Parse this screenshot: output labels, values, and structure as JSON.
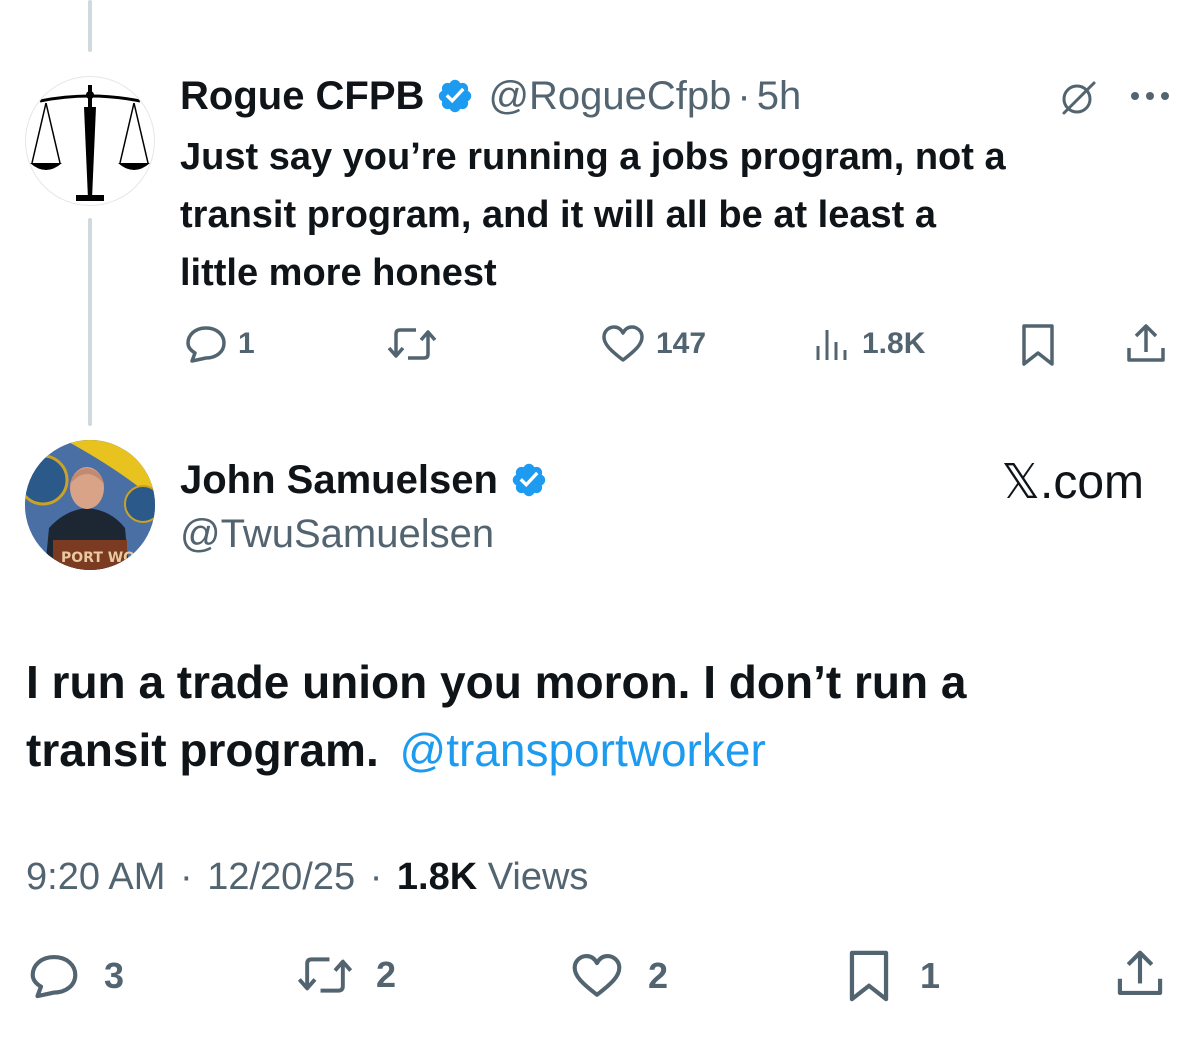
{
  "parent_tweet": {
    "display_name": "Rogue CFPB",
    "handle": "@RogueCfpb",
    "separator": "·",
    "time": "5h",
    "text_lines": [
      "Just say you’re running a jobs program, not a",
      "transit program, and it will all be at least a",
      "little more honest"
    ],
    "actions": {
      "reply_count": "1",
      "retweet_count": "",
      "like_count": "147",
      "view_count": "1.8K"
    }
  },
  "main_tweet": {
    "display_name": "John Samuelsen",
    "handle": "@TwuSamuelsen",
    "brand": "𝕏.com",
    "text_line_1": "I run a trade union you moron. I don’t run a",
    "text_line_2_prefix": "transit program.",
    "mention": "@transportworker",
    "meta": {
      "time": "9:20 AM",
      "sep1": "·",
      "date": "12/20/25",
      "sep2": "·",
      "views_count": "1.8K",
      "views_label": "Views"
    },
    "actions": {
      "reply_count": "3",
      "retweet_count": "2",
      "like_count": "2",
      "bookmark_count": "1"
    }
  },
  "colors": {
    "verified": "#1d9bf0",
    "link": "#1d9bf0",
    "muted": "#536471",
    "thread_line": "#cfd9de"
  },
  "icons": [
    "reply-icon",
    "retweet-icon",
    "like-icon",
    "views-icon",
    "bookmark-icon",
    "share-icon",
    "grok-icon",
    "more-icon",
    "verified-badge-icon"
  ]
}
